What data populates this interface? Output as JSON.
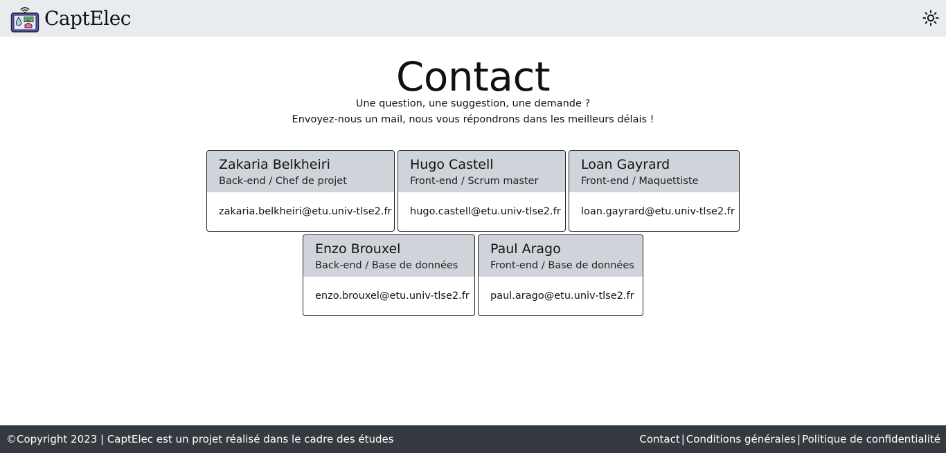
{
  "header": {
    "brand_name": "CaptElec",
    "logo_icon": "tablet-sensor-icon",
    "theme_toggle_icon": "sun-icon"
  },
  "contact": {
    "title": "Contact",
    "subtitle_line1": "Une question, une suggestion, une demande ?",
    "subtitle_line2": "Envoyez-nous un mail, nous vous répondrons dans les meilleurs délais !"
  },
  "members": [
    {
      "name": "Zakaria Belkheiri",
      "role": "Back-end / Chef de projet",
      "email": "zakaria.belkheiri@etu.univ-tlse2.fr"
    },
    {
      "name": "Hugo Castell",
      "role": "Front-end / Scrum master",
      "email": "hugo.castell@etu.univ-tlse2.fr"
    },
    {
      "name": "Loan Gayrard",
      "role": "Front-end / Maquettiste",
      "email": "loan.gayrard@etu.univ-tlse2.fr"
    },
    {
      "name": "Enzo Brouxel",
      "role": "Back-end / Base de données",
      "email": "enzo.brouxel@etu.univ-tlse2.fr"
    },
    {
      "name": "Paul Arago",
      "role": "Front-end / Base de données",
      "email": "paul.arago@etu.univ-tlse2.fr"
    }
  ],
  "footer": {
    "copyright": "©Copyright 2023 | CaptElec est un projet réalisé dans le cadre des études",
    "links": [
      "Contact",
      "Conditions générales",
      "Politique de confidentialité"
    ],
    "separator": "|"
  },
  "colors": {
    "navbar_bg": "#e9ecef",
    "card_header_bg": "#ced4da",
    "footer_bg": "#343a40"
  }
}
